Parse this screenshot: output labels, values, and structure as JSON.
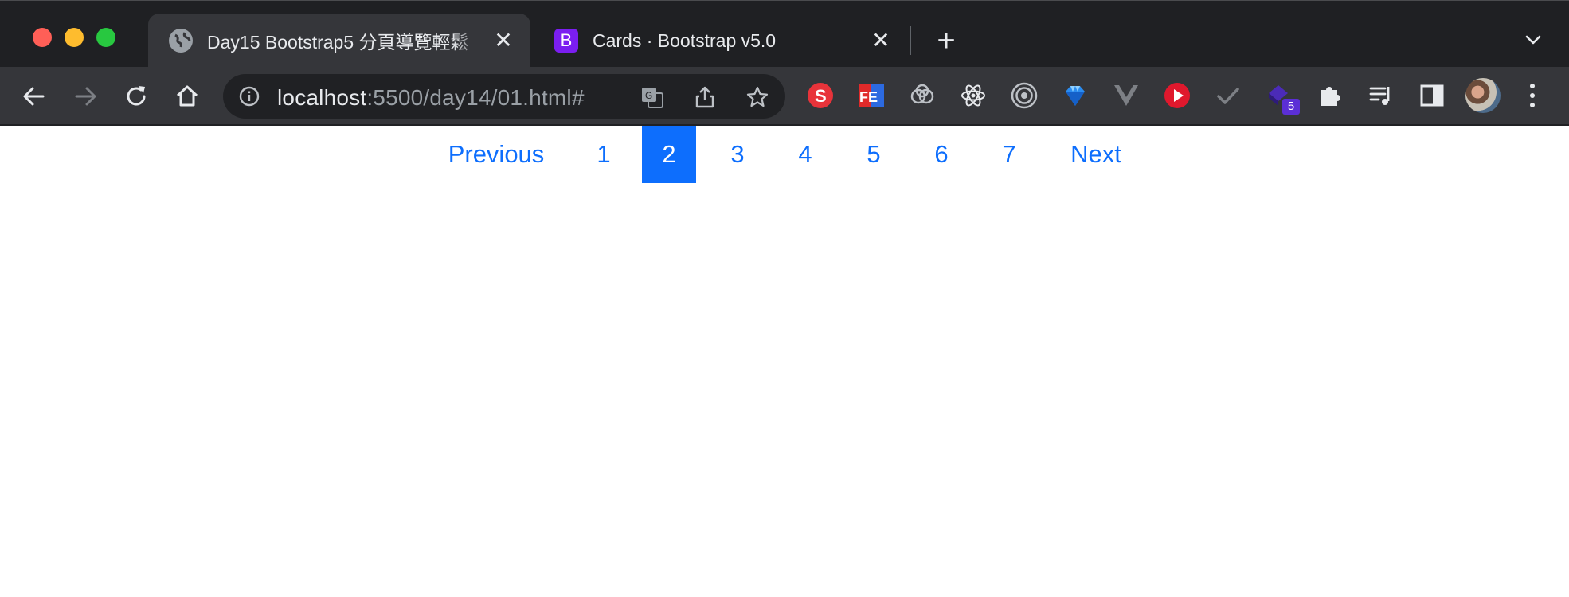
{
  "window": {
    "controls": [
      "close",
      "minimize",
      "zoom"
    ]
  },
  "tabs": [
    {
      "title": "Day15 Bootstrap5 分頁導覽輕鬆",
      "favicon": "globe-icon",
      "active": true
    },
    {
      "title": "Cards · Bootstrap v5.0",
      "favicon": "B",
      "active": false
    }
  ],
  "omnibox": {
    "host": "localhost",
    "path": ":5500/day14/01.html#"
  },
  "extensions": {
    "badge_count": "5"
  },
  "pagination": {
    "previous_label": "Previous",
    "pages": [
      "1",
      "2",
      "3",
      "4",
      "5",
      "6",
      "7"
    ],
    "active_page": "2",
    "next_label": "Next"
  },
  "colors": {
    "link": "#0d6efd",
    "active_bg": "#0d6efd"
  }
}
